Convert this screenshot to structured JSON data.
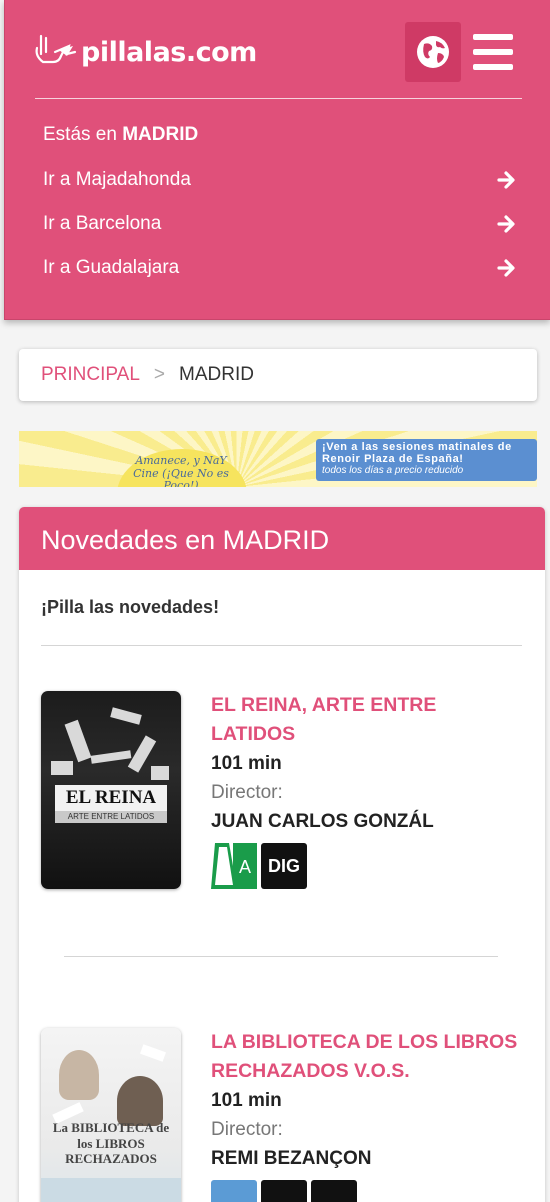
{
  "header": {
    "logo_text": "pillalas.com",
    "current_prefix": "Estás en",
    "current_city": "MADRID",
    "city_links": [
      {
        "label": "Ir a Majadahonda"
      },
      {
        "label": "Ir a Barcelona"
      },
      {
        "label": "Ir a Guadalajara"
      }
    ],
    "icons": {
      "globe": "globe-icon",
      "menu": "hamburger-menu-icon",
      "arrow": "arrow-right-icon"
    }
  },
  "breadcrumb": {
    "home": "PRINCIPAL",
    "separator": ">",
    "current": "MADRID"
  },
  "banner": {
    "sun_text": "Amanece, y NaY Cine (¡Que No es Poco!)",
    "line1": "¡Ven a las sesiones matinales de",
    "line2": "Renoir Plaza de España!",
    "line3": "todos los días a precio reducido"
  },
  "news": {
    "title": "Novedades en MADRID",
    "subtitle": "¡Pilla las novedades!",
    "movies": [
      {
        "title": "EL REINA, ARTE ENTRE LATIDOS",
        "duration": "101 min",
        "director_label": "Director:",
        "director": "JUAN CARLOS GONZÁL",
        "poster_title": "EL REINA",
        "poster_sub": "ARTE ENTRE LATIDOS",
        "badges": [
          "A",
          "DIG"
        ]
      },
      {
        "title": "LA BIBLIOTECA DE LOS LIBROS RECHAZADOS V.O.S.",
        "duration": "101 min",
        "director_label": "Director:",
        "director": "REMI BEZANÇON",
        "poster_title": "La BIBLIOTECA de los LIBROS RECHAZADOS"
      }
    ]
  },
  "colors": {
    "brand": "#e0507a",
    "brand_dark": "#cf3a65",
    "badge_green": "#1a9c4a"
  }
}
